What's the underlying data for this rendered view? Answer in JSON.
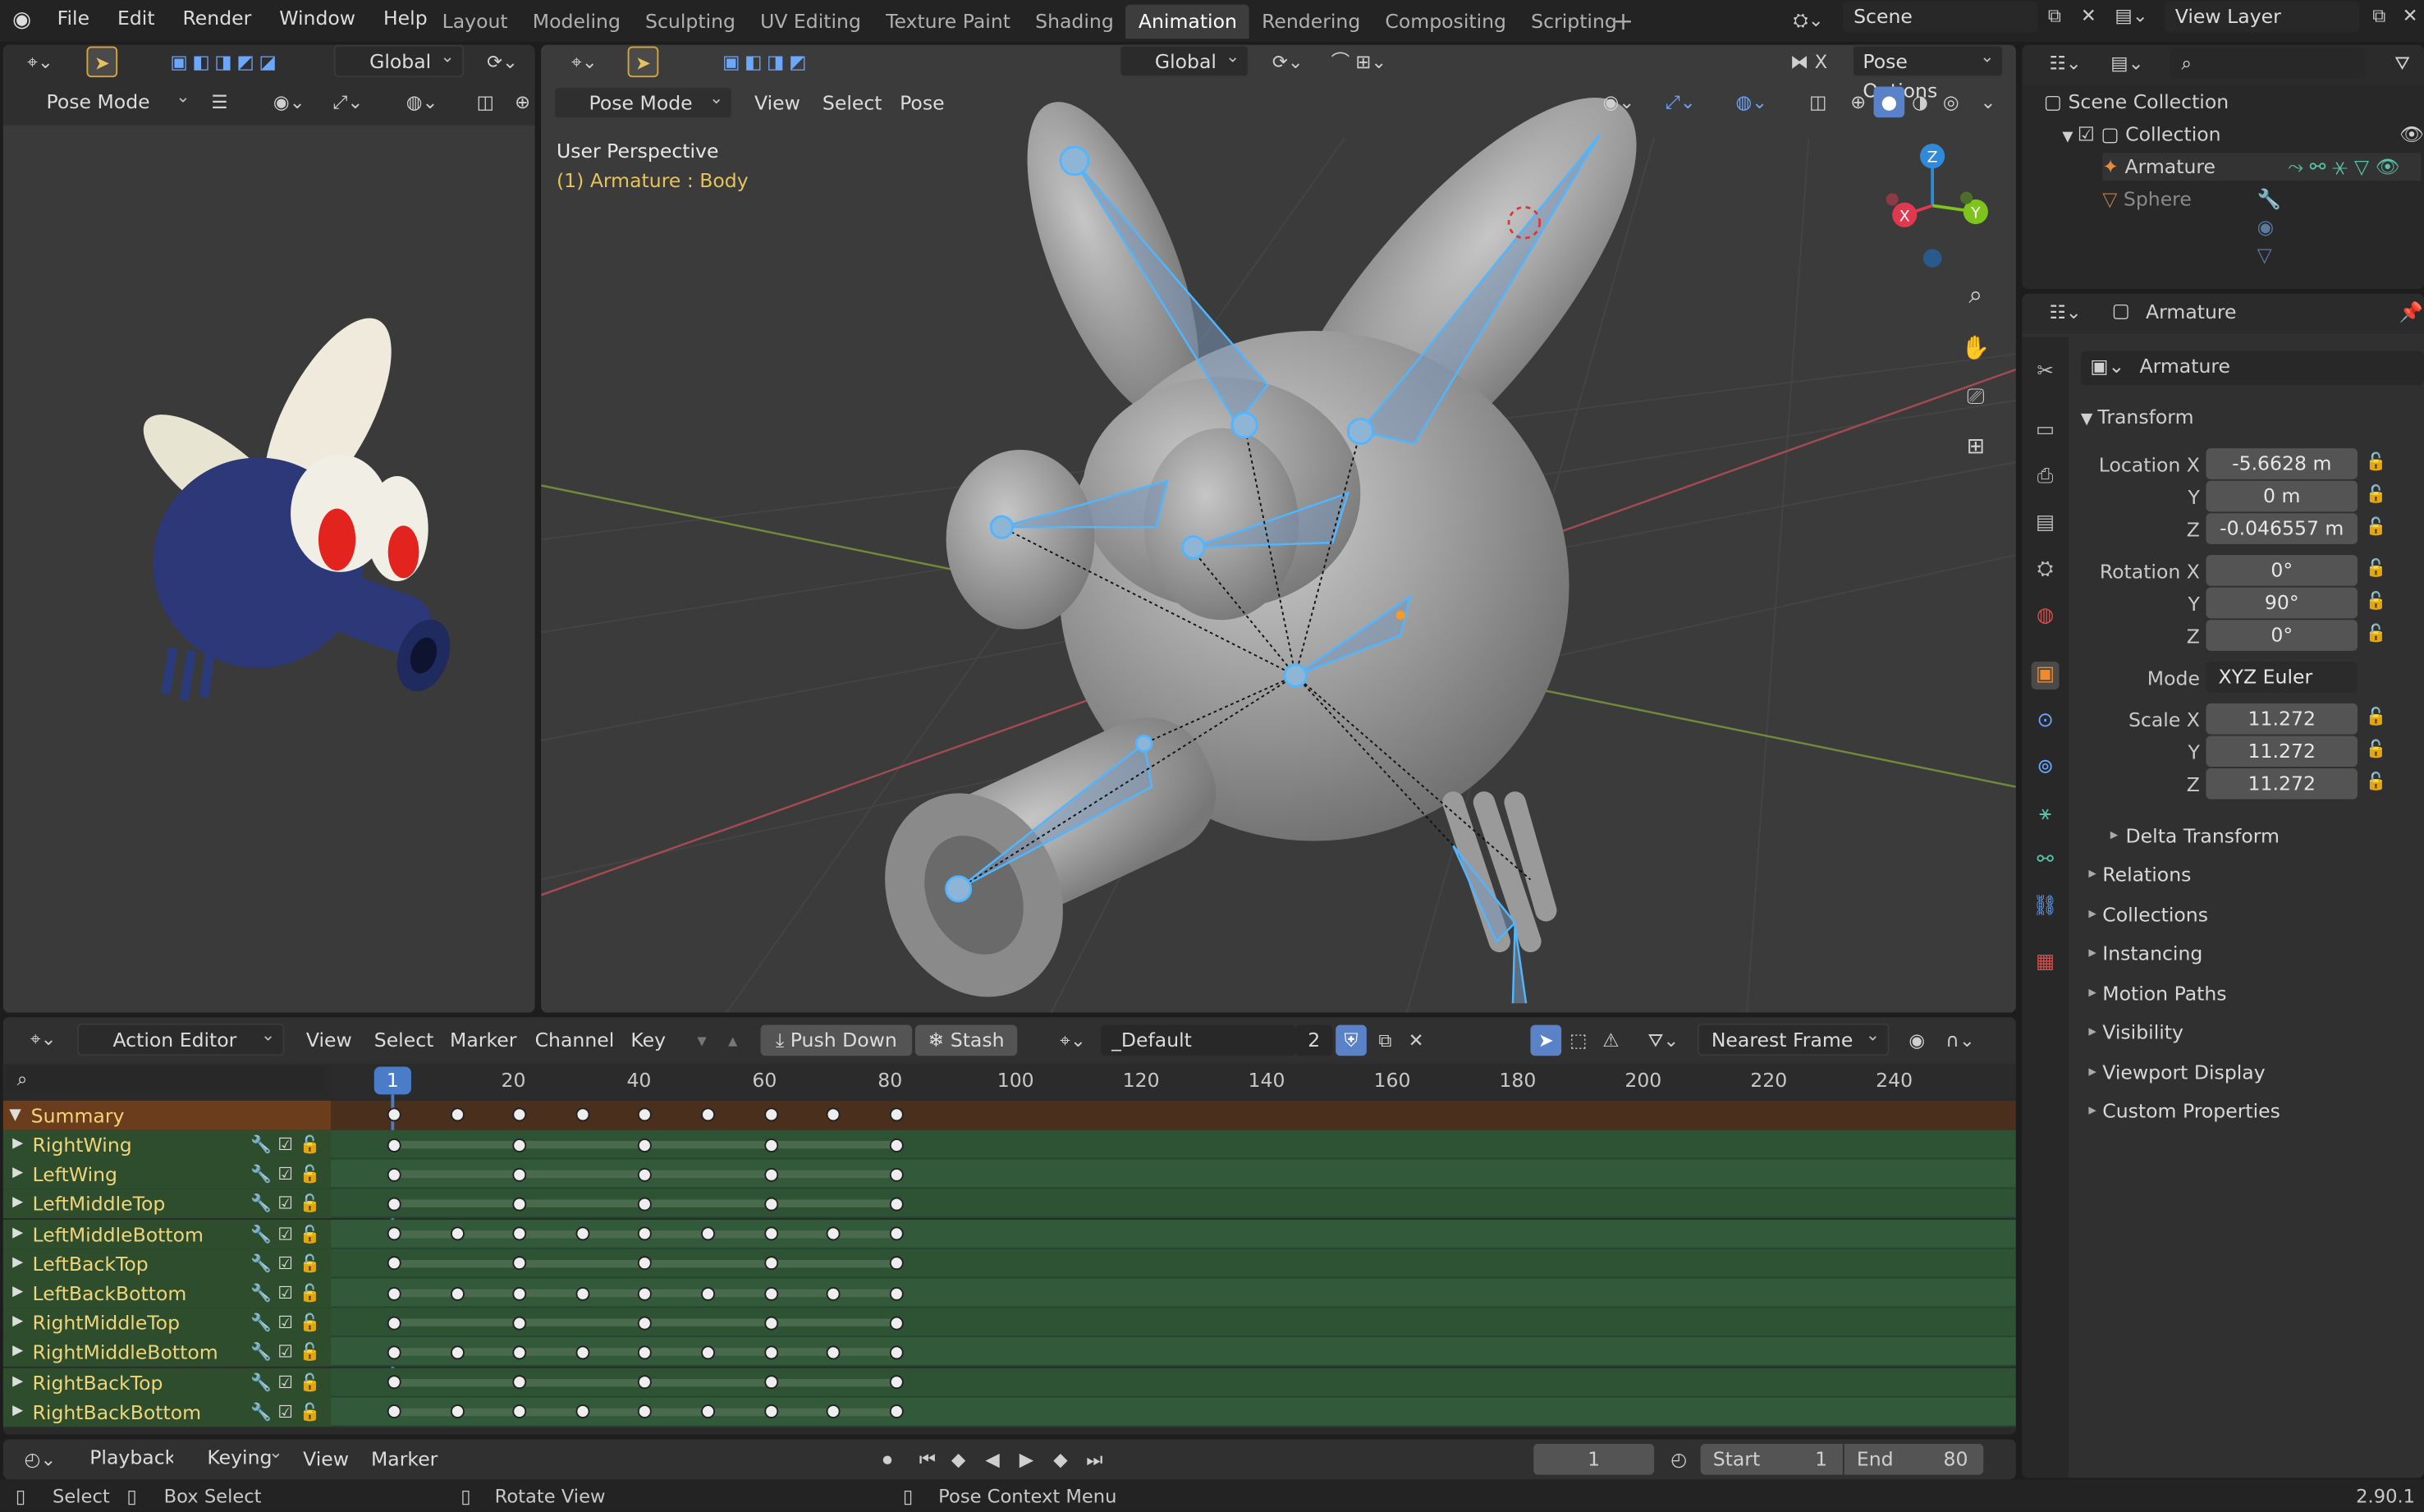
{
  "menu": [
    "File",
    "Edit",
    "Render",
    "Window",
    "Help"
  ],
  "workspaces": [
    "Layout",
    "Modeling",
    "Sculpting",
    "UV Editing",
    "Texture Paint",
    "Shading",
    "Animation",
    "Rendering",
    "Compositing",
    "Scripting"
  ],
  "active_workspace": "Animation",
  "scene": "Scene",
  "view_layer": "View Layer",
  "left_viewport": {
    "orientation": "Global",
    "mode": "Pose Mode"
  },
  "viewport": {
    "mode": "Pose Mode",
    "menus": [
      "View",
      "Select",
      "Pose"
    ],
    "orientation": "Global",
    "pose_options": "Pose Options",
    "perspective": "User Perspective",
    "active": "(1) Armature : Body"
  },
  "gizmo": {
    "x": "X",
    "y": "Y",
    "z": "Z",
    "x_color": "#e0384e",
    "y_color": "#7fc41d",
    "z_color": "#2f8bda"
  },
  "outliner": {
    "root": "Scene Collection",
    "collection": "Collection",
    "items": [
      "Armature",
      "Sphere"
    ]
  },
  "properties": {
    "object": "Armature",
    "data_name": "Armature",
    "transform_title": "Transform",
    "location": {
      "label": "Location X",
      "y": "Y",
      "z": "Z",
      "x_val": "-5.6628 m",
      "y_val": "0 m",
      "z_val": "-0.046557 m"
    },
    "rotation": {
      "label": "Rotation X",
      "y": "Y",
      "z": "Z",
      "x_val": "0°",
      "y_val": "90°",
      "z_val": "0°"
    },
    "mode": {
      "label": "Mode",
      "value": "XYZ Euler"
    },
    "scale": {
      "label": "Scale X",
      "y": "Y",
      "z": "Z",
      "x_val": "11.272",
      "y_val": "11.272",
      "z_val": "11.272"
    },
    "delta": "Delta Transform",
    "panels": [
      "Relations",
      "Collections",
      "Instancing",
      "Motion Paths",
      "Visibility",
      "Viewport Display",
      "Custom Properties"
    ]
  },
  "action_editor": {
    "editor": "Action Editor",
    "menus": [
      "View",
      "Select",
      "Marker",
      "Channel",
      "Key"
    ],
    "push_down": "Push Down",
    "stash": "Stash",
    "action": "_Default",
    "users": "2",
    "snap": "Nearest Frame",
    "current_frame_badge": "1",
    "ruler": [
      "20",
      "40",
      "60",
      "80",
      "100",
      "120",
      "140",
      "160",
      "180",
      "200",
      "220",
      "240"
    ],
    "summary": "Summary",
    "channels": [
      "RightWing",
      "LeftWing",
      "LeftMiddleTop",
      "LeftMiddleBottom",
      "LeftBackTop",
      "LeftBackBottom",
      "RightMiddleTop",
      "RightMiddleBottom",
      "RightBackTop",
      "RightBackBottom"
    ],
    "keyframes": {
      "summary": [
        1,
        11,
        21,
        31,
        41,
        51,
        61,
        71,
        81
      ],
      "rows": [
        [
          1,
          21,
          41,
          61,
          81
        ],
        [
          1,
          21,
          41,
          61,
          81
        ],
        [
          1,
          21,
          41,
          61,
          81
        ],
        [
          1,
          11,
          21,
          31,
          41,
          51,
          61,
          71,
          81
        ],
        [
          1,
          21,
          41,
          61,
          81
        ],
        [
          1,
          11,
          21,
          31,
          41,
          51,
          61,
          71,
          81
        ],
        [
          1,
          21,
          41,
          61,
          81
        ],
        [
          1,
          11,
          21,
          31,
          41,
          51,
          61,
          71,
          81
        ],
        [
          1,
          21,
          41,
          61,
          81
        ],
        [
          1,
          11,
          21,
          31,
          41,
          51,
          61,
          71,
          81
        ]
      ]
    }
  },
  "timeline": {
    "menus": [
      "Playback",
      "Keying",
      "View",
      "Marker"
    ],
    "current": "1",
    "start_label": "Start",
    "start": "1",
    "end_label": "End",
    "end": "80"
  },
  "status": {
    "select": "Select",
    "box_select": "Box Select",
    "rotate": "Rotate View",
    "context": "Pose Context Menu",
    "version": "2.90.1"
  }
}
